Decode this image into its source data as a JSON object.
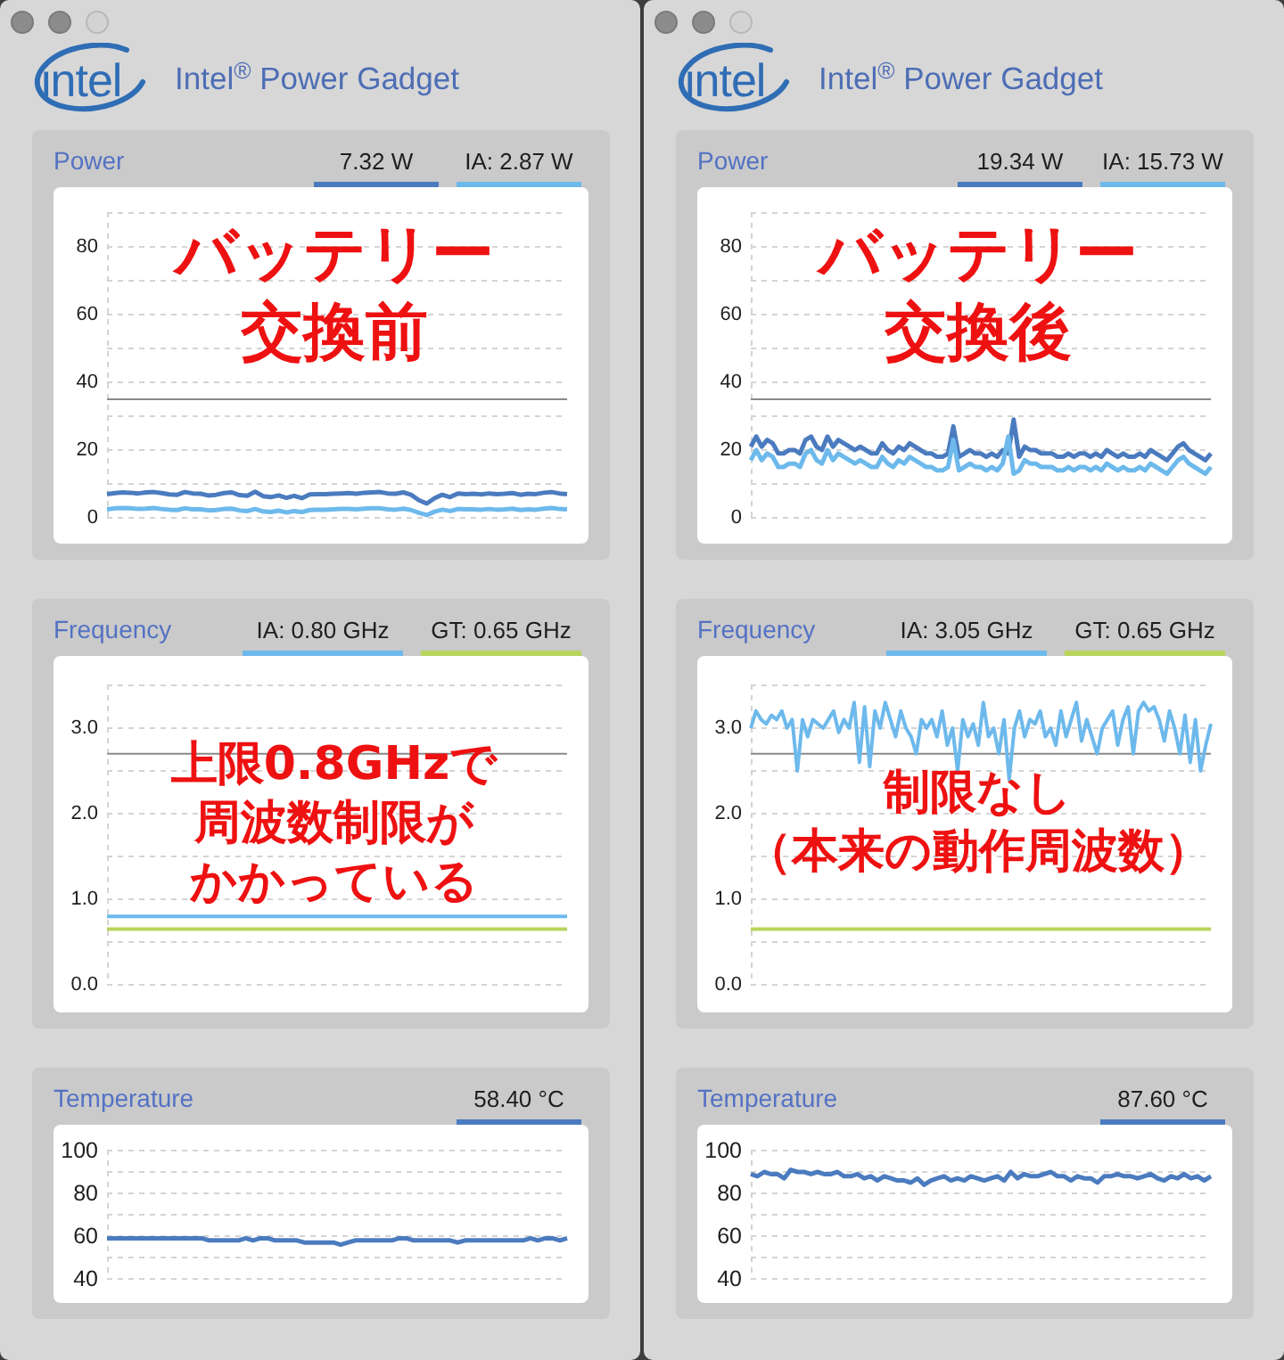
{
  "windows": [
    {
      "controls": [
        {
          "disabled": false
        },
        {
          "disabled": false
        },
        {
          "disabled": true
        }
      ],
      "logo": "intel",
      "title": "Intel$^{®}$ Power Gadget",
      "panels": [
        {
          "kind": "power",
          "title": "Power",
          "legend": [
            "7.32 W",
            "IA: 2.87 W"
          ],
          "caption_lines": [
            "バッテリー",
            "交換前"
          ],
          "chart_data": {
            "type": "line",
            "ylim": [
              0,
              90
            ],
            "yticks": [
              0,
              20,
              40,
              60,
              80
            ],
            "grid": true,
            "ref_lines": [
              {
                "axis": "y",
                "value": 35
              }
            ],
            "series": [
              {
                "color": "#4b7bbf",
                "values": [
                  7.0,
                  7.3,
                  7.5,
                  7.4,
                  7.2,
                  7.5,
                  7.6,
                  7.3,
                  6.9,
                  6.8,
                  7.6,
                  7.2,
                  7.1,
                  6.6,
                  6.8,
                  7.3,
                  7.5,
                  6.7,
                  6.5,
                  7.7,
                  6.4,
                  6.1,
                  6.6,
                  5.9,
                  6.5,
                  5.8,
                  6.9,
                  7.0,
                  7.0,
                  7.1,
                  7.2,
                  7.3,
                  7.1,
                  7.4,
                  7.5,
                  7.6,
                  7.2,
                  7.1,
                  7.5,
                  6.8,
                  5.2,
                  4.2,
                  5.8,
                  6.8,
                  6.1,
                  7.2,
                  7.0,
                  7.1,
                  6.9,
                  7.2,
                  7.0,
                  7.1,
                  7.3,
                  6.8,
                  7.1,
                  7.0,
                  7.4,
                  7.6,
                  7.2,
                  7.0
                ]
              },
              {
                "color": "#6db9ec",
                "values": [
                  2.5,
                  2.8,
                  2.9,
                  2.8,
                  2.6,
                  2.7,
                  2.9,
                  2.6,
                  2.4,
                  2.3,
                  2.8,
                  2.5,
                  2.5,
                  2.2,
                  2.3,
                  2.6,
                  2.7,
                  2.2,
                  2.0,
                  2.6,
                  1.9,
                  1.7,
                  2.1,
                  1.6,
                  2.0,
                  1.7,
                  2.3,
                  2.4,
                  2.4,
                  2.5,
                  2.6,
                  2.6,
                  2.5,
                  2.7,
                  2.8,
                  2.8,
                  2.5,
                  2.4,
                  2.7,
                  2.3,
                  1.5,
                  0.8,
                  1.8,
                  2.4,
                  2.0,
                  2.6,
                  2.5,
                  2.5,
                  2.4,
                  2.6,
                  2.4,
                  2.5,
                  2.7,
                  2.3,
                  2.5,
                  2.4,
                  2.7,
                  2.9,
                  2.6,
                  2.5
                ]
              }
            ]
          }
        },
        {
          "kind": "frequency",
          "title": "Frequency",
          "legend": [
            "IA: 0.80 GHz",
            "GT: 0.65 GHz"
          ],
          "caption_lines": [
            "上限0.8GHzで",
            "周波数制限が",
            "かかっている"
          ],
          "chart_data": {
            "type": "line",
            "ylim": [
              0,
              3.5
            ],
            "yticks": [
              {
                "value": 0,
                "label": "0.0"
              },
              {
                "value": 1,
                "label": "1.0"
              },
              {
                "value": 2,
                "label": "2.0"
              },
              {
                "value": 3,
                "label": "3.0"
              }
            ],
            "grid": true,
            "ref_lines": [
              {
                "axis": "y",
                "value": 2.7
              }
            ],
            "series": [
              {
                "color": "#6db9ec",
                "values": [
                  0.8,
                  0.8,
                  0.8,
                  0.8,
                  0.8,
                  0.8,
                  0.8,
                  0.8,
                  0.8,
                  0.8,
                  0.8,
                  0.8,
                  0.8,
                  0.8,
                  0.8,
                  0.8,
                  0.8,
                  0.8,
                  0.8,
                  0.8,
                  0.8,
                  0.8,
                  0.8,
                  0.8,
                  0.8,
                  0.8,
                  0.8,
                  0.8,
                  0.8,
                  0.8
                ]
              },
              {
                "color": "#b9d45c",
                "values": [
                  0.65,
                  0.65,
                  0.65,
                  0.65,
                  0.65,
                  0.65,
                  0.65,
                  0.65,
                  0.65,
                  0.65,
                  0.65,
                  0.65,
                  0.65,
                  0.65,
                  0.65,
                  0.65,
                  0.65,
                  0.65,
                  0.65,
                  0.65,
                  0.65,
                  0.65,
                  0.65,
                  0.65,
                  0.65,
                  0.65,
                  0.65,
                  0.65,
                  0.65,
                  0.65
                ]
              }
            ]
          }
        },
        {
          "kind": "temperature",
          "title": "Temperature",
          "legend": [
            "58.40 °C"
          ],
          "chart_data": {
            "type": "line",
            "ylim": [
              40,
              100
            ],
            "yticks": [
              40,
              60,
              80,
              100
            ],
            "grid": true,
            "series": [
              {
                "color": "#4b7bbf",
                "values": [
                  59,
                  59,
                  59,
                  59,
                  59,
                  59,
                  59,
                  59,
                  59,
                  59,
                  59,
                  59,
                  59,
                  59,
                  58,
                  58,
                  58,
                  58,
                  58,
                  59,
                  58,
                  59,
                  59,
                  58,
                  58,
                  58,
                  58,
                  57,
                  57,
                  57,
                  57,
                  57,
                  56,
                  57,
                  58,
                  58,
                  58,
                  58,
                  58,
                  58,
                  59,
                  59,
                  58,
                  58,
                  58,
                  58,
                  58,
                  58,
                  57,
                  58,
                  58,
                  58,
                  58,
                  58,
                  58,
                  58,
                  58,
                  58,
                  59,
                  58,
                  59,
                  59,
                  58,
                  59
                ]
              }
            ]
          }
        }
      ]
    },
    {
      "controls": [
        {
          "disabled": false
        },
        {
          "disabled": false
        },
        {
          "disabled": true
        }
      ],
      "logo": "intel",
      "title": "Intel$^{®}$ Power Gadget",
      "panels": [
        {
          "kind": "power",
          "title": "Power",
          "legend": [
            "19.34 W",
            "IA: 15.73 W"
          ],
          "caption_lines": [
            "バッテリー",
            "交換後"
          ],
          "chart_data": {
            "type": "line",
            "ylim": [
              0,
              90
            ],
            "yticks": [
              0,
              20,
              40,
              60,
              80
            ],
            "grid": true,
            "ref_lines": [
              {
                "axis": "y",
                "value": 35
              }
            ],
            "series": [
              {
                "color": "#4b7bbf",
                "values": [
                  21,
                  24,
                  21,
                  23,
                  22,
                  19,
                  19,
                  20,
                  20,
                  19,
                  23,
                  24,
                  21,
                  20,
                  24,
                  21,
                  23,
                  22,
                  21,
                  20,
                  21,
                  20,
                  19,
                  19,
                  22,
                  20,
                  19,
                  21,
                  20,
                  22,
                  21,
                  20,
                  19,
                  19,
                  18,
                  18,
                  19,
                  27,
                  18,
                  19,
                  20,
                  19,
                  19,
                  18,
                  19,
                  18,
                  20,
                  19,
                  29,
                  18,
                  21,
                  20,
                  20,
                  19,
                  19,
                  19,
                  18,
                  18,
                  19,
                  18,
                  19,
                  19,
                  18,
                  19,
                  18,
                  20,
                  19,
                  18,
                  19,
                  18,
                  18,
                  19,
                  18,
                  20,
                  19,
                  18,
                  17,
                  19,
                  21,
                  22,
                  20,
                  19,
                  18,
                  17,
                  19
                ]
              },
              {
                "color": "#6db9ec",
                "values": [
                  17,
                  20,
                  17,
                  19,
                  18,
                  15,
                  15,
                  16,
                  16,
                  15,
                  19,
                  20,
                  17,
                  16,
                  20,
                  17,
                  19,
                  18,
                  17,
                  16,
                  17,
                  16,
                  15,
                  15,
                  18,
                  16,
                  15,
                  17,
                  16,
                  18,
                  17,
                  16,
                  15,
                  15,
                  14,
                  14,
                  15,
                  23,
                  14,
                  15,
                  16,
                  15,
                  15,
                  14,
                  15,
                  14,
                  16,
                  24,
                  13,
                  14,
                  17,
                  16,
                  16,
                  15,
                  15,
                  15,
                  14,
                  14,
                  15,
                  14,
                  15,
                  15,
                  14,
                  15,
                  14,
                  16,
                  15,
                  14,
                  15,
                  14,
                  14,
                  15,
                  14,
                  16,
                  15,
                  14,
                  13,
                  15,
                  17,
                  18,
                  16,
                  15,
                  14,
                  13,
                  15
                ]
              }
            ]
          }
        },
        {
          "kind": "frequency",
          "title": "Frequency",
          "legend": [
            "IA: 3.05 GHz",
            "GT: 0.65 GHz"
          ],
          "caption_lines": [
            "制限なし",
            "（本来の動作周波数）"
          ],
          "chart_data": {
            "type": "line",
            "ylim": [
              0,
              3.5
            ],
            "yticks": [
              {
                "value": 0,
                "label": "0.0"
              },
              {
                "value": 1,
                "label": "1.0"
              },
              {
                "value": 2,
                "label": "2.0"
              },
              {
                "value": 3,
                "label": "3.0"
              }
            ],
            "grid": true,
            "ref_lines": [
              {
                "axis": "y",
                "value": 2.7
              }
            ],
            "series": [
              {
                "color": "#6db9ec",
                "values": [
                  3.0,
                  3.2,
                  3.1,
                  3.05,
                  3.15,
                  3.1,
                  3.2,
                  3.0,
                  3.1,
                  2.5,
                  3.1,
                  2.9,
                  3.1,
                  3.05,
                  3.0,
                  3.1,
                  3.2,
                  2.95,
                  3.1,
                  3.0,
                  3.3,
                  2.6,
                  3.25,
                  2.55,
                  3.2,
                  3.0,
                  3.3,
                  3.1,
                  2.9,
                  3.2,
                  3.0,
                  2.9,
                  2.7,
                  3.1,
                  3.0,
                  3.1,
                  2.9,
                  3.2,
                  2.8,
                  3.0,
                  2.5,
                  3.1,
                  2.9,
                  3.05,
                  2.8,
                  3.3,
                  2.9,
                  3.0,
                  2.7,
                  3.1,
                  2.4,
                  3.0,
                  3.2,
                  2.9,
                  3.1,
                  3.05,
                  3.2,
                  2.9,
                  3.0,
                  2.8,
                  3.2,
                  2.9,
                  3.1,
                  3.3,
                  2.85,
                  3.1,
                  2.9,
                  2.7,
                  3.0,
                  3.1,
                  3.2,
                  2.8,
                  3.1,
                  3.25,
                  2.7,
                  3.2,
                  3.3,
                  3.2,
                  3.25,
                  3.1,
                  2.85,
                  3.2,
                  3.0,
                  2.7,
                  3.15,
                  2.6,
                  3.1,
                  2.5,
                  2.8,
                  3.05
                ]
              },
              {
                "color": "#b9d45c",
                "values": [
                  0.65,
                  0.65,
                  0.65,
                  0.65,
                  0.65,
                  0.65,
                  0.65,
                  0.65,
                  0.65,
                  0.65,
                  0.65,
                  0.65,
                  0.65,
                  0.65,
                  0.65,
                  0.65,
                  0.65,
                  0.65,
                  0.65,
                  0.65,
                  0.65,
                  0.65,
                  0.65,
                  0.65,
                  0.65,
                  0.65,
                  0.65,
                  0.65,
                  0.65,
                  0.65,
                  0.65,
                  0.65,
                  0.65,
                  0.65,
                  0.65,
                  0.65,
                  0.65,
                  0.65,
                  0.65,
                  0.65,
                  0.65,
                  0.65,
                  0.65,
                  0.65,
                  0.65,
                  0.65,
                  0.65,
                  0.65,
                  0.65,
                  0.65,
                  0.65,
                  0.65,
                  0.65,
                  0.65,
                  0.65,
                  0.65,
                  0.65,
                  0.65,
                  0.65,
                  0.65,
                  0.65,
                  0.65,
                  0.65,
                  0.65,
                  0.65,
                  0.65,
                  0.65,
                  0.65,
                  0.65,
                  0.65,
                  0.65,
                  0.65,
                  0.65,
                  0.65,
                  0.65,
                  0.65,
                  0.65,
                  0.65,
                  0.65,
                  0.65,
                  0.65,
                  0.65,
                  0.65,
                  0.65,
                  0.65,
                  0.65,
                  0.65,
                  0.65,
                  0.65,
                  0.65
                ]
              }
            ]
          }
        },
        {
          "kind": "temperature",
          "title": "Temperature",
          "legend": [
            "87.60 °C"
          ],
          "chart_data": {
            "type": "line",
            "ylim": [
              40,
              100
            ],
            "yticks": [
              40,
              60,
              80,
              100
            ],
            "grid": true,
            "series": [
              {
                "color": "#4b7bbf",
                "values": [
                  89,
                  88,
                  90,
                  89,
                  89,
                  87,
                  91,
                  90,
                  90,
                  89,
                  90,
                  89,
                  89,
                  90,
                  88,
                  88,
                  89,
                  87,
                  88,
                  86,
                  88,
                  87,
                  86,
                  86,
                  85,
                  87,
                  84,
                  86,
                  87,
                  88,
                  86,
                  87,
                  86,
                  88,
                  87,
                  86,
                  87,
                  88,
                  86,
                  90,
                  87,
                  89,
                  88,
                  88,
                  89,
                  90,
                  88,
                  88,
                  86,
                  88,
                  87,
                  87,
                  85,
                  88,
                  88,
                  89,
                  88,
                  88,
                  87,
                  88,
                  89,
                  87,
                  86,
                  88,
                  87,
                  89,
                  87,
                  88,
                  86,
                  88
                ]
              }
            ]
          }
        }
      ]
    }
  ]
}
